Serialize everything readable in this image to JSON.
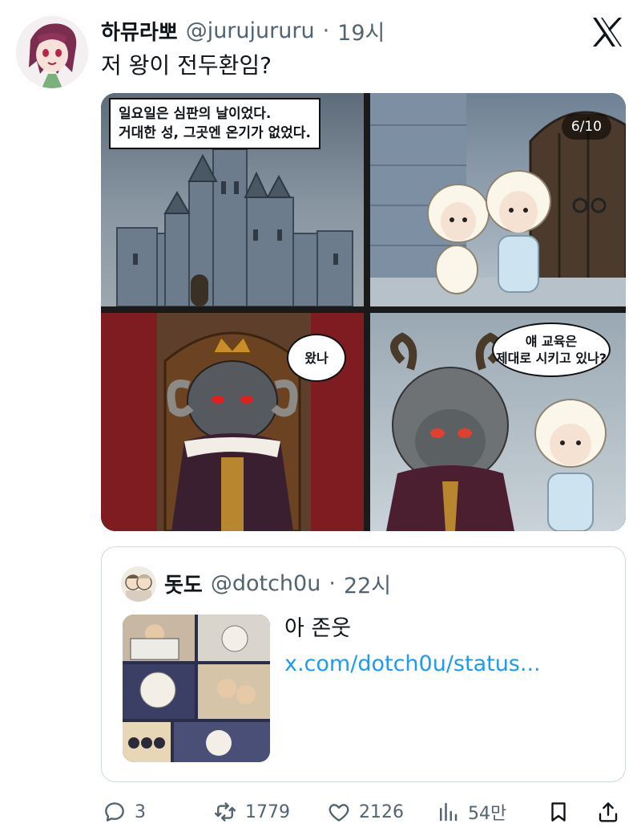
{
  "tweet": {
    "display_name": "하뮤라뽀",
    "handle": "@jurujururu",
    "separator": "·",
    "time": "19시",
    "text": "저 왕이 전두환임?"
  },
  "media": {
    "panel1_caption_line1": "일요일은 심판의 날이었다.",
    "panel1_caption_line2": "거대한 성, 그곳엔 온기가 없었다.",
    "panel3_bubble": "왔나",
    "panel4_bubble_line1": "얘 교육은",
    "panel4_bubble_line2": "제대로 시키고 있나?",
    "page_counter": "6/10"
  },
  "quote": {
    "display_name": "돗도",
    "handle": "@dotch0u",
    "separator": "·",
    "time": "22시",
    "text": "아 존웃 ",
    "link": "x.com/dotch0u/status..."
  },
  "actions": {
    "replies": "3",
    "reposts": "1779",
    "likes": "2126",
    "views": "54만"
  },
  "colors": {
    "link": "#1d9bf0",
    "secondary_text": "#536471",
    "border": "#cfd9de"
  },
  "icons": [
    "x-logo-icon",
    "reply-icon",
    "repost-icon",
    "like-icon",
    "views-icon",
    "bookmark-icon",
    "share-icon"
  ]
}
